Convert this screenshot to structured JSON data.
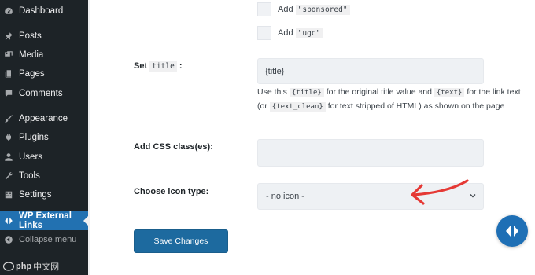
{
  "sidebar": {
    "items": [
      {
        "label": "Dashboard",
        "icon": "dashboard-icon"
      },
      {
        "label": "Posts",
        "icon": "pin-icon"
      },
      {
        "label": "Media",
        "icon": "media-icon"
      },
      {
        "label": "Pages",
        "icon": "page-icon"
      },
      {
        "label": "Comments",
        "icon": "comment-icon"
      },
      {
        "label": "Appearance",
        "icon": "brush-icon"
      },
      {
        "label": "Plugins",
        "icon": "plugin-icon"
      },
      {
        "label": "Users",
        "icon": "user-icon"
      },
      {
        "label": "Tools",
        "icon": "wrench-icon"
      },
      {
        "label": "Settings",
        "icon": "settings-icon"
      },
      {
        "label": "WP External Links",
        "icon": "external-links-icon",
        "active": true
      },
      {
        "label": "Collapse menu",
        "icon": "collapse-icon"
      }
    ],
    "watermark": {
      "prefix": "php",
      "suffix": "中文网"
    }
  },
  "rel_options": {
    "sponsored": {
      "prefix": "Add",
      "code": "\"sponsored\""
    },
    "ugc": {
      "prefix": "Add",
      "code": "\"ugc\""
    }
  },
  "set_title": {
    "label_prefix": "Set",
    "label_code": "title",
    "label_suffix": ":",
    "value": "{title}",
    "help": {
      "t1": "Use this",
      "c1": "{title}",
      "t2": "for the original title value and",
      "c2": "{text}",
      "t3": "for the link text (or",
      "c3": "{text_clean}",
      "t4": "for text stripped of HTML) as shown on the page"
    }
  },
  "css_class": {
    "label": "Add CSS class(es):",
    "value": ""
  },
  "icon_type": {
    "label": "Choose icon type:",
    "selected": "- no icon -"
  },
  "save_label": "Save Changes",
  "colors": {
    "sidebar": "#1d2327",
    "active": "#2271b1",
    "button": "#1d6a9f",
    "annotation_arrow": "#e53935"
  }
}
